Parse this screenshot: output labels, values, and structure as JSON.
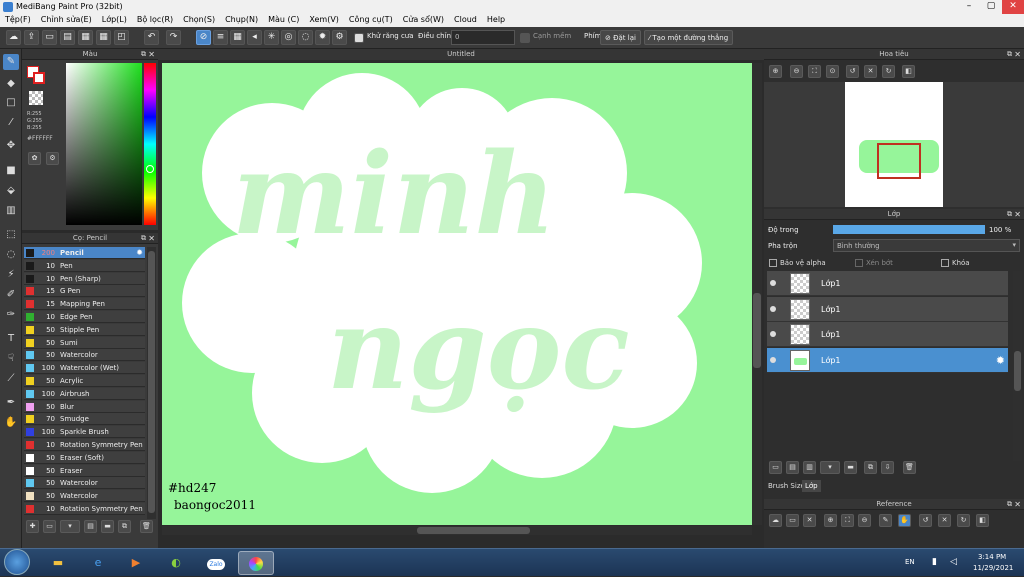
{
  "window": {
    "title": "MediBang Paint Pro (32bit)",
    "min": "–",
    "max": "▢",
    "close": "✕"
  },
  "menu": [
    "Tệp(F)",
    "Chỉnh sửa(E)",
    "Lớp(L)",
    "Bộ lọc(R)",
    "Chọn(S)",
    "Chụp(N)",
    "Màu (C)",
    "Xem(V)",
    "Công cụ(T)",
    "Cửa sổ(W)",
    "Cloud",
    "Help"
  ],
  "toolbar": {
    "antialias_label": "Khử răng cưa",
    "adjust_label": "Điều chỉnh",
    "adjust_value": "0",
    "edge_label": "Cạnh mềm",
    "key_label": "Phím",
    "reset_label": "Đặt lại",
    "straight_line_label": "Tạo một đường thẳng"
  },
  "color_panel": {
    "title": "Màu",
    "r": "R:255",
    "g": "G:255",
    "b": "B:255",
    "hex": "#FFFFFF"
  },
  "brush_panel": {
    "title": "Cọ: Pencil",
    "brushes": [
      {
        "size": "200",
        "name": "Pencil",
        "color": "#1a1a1a",
        "selected": true
      },
      {
        "size": "10",
        "name": "Pen",
        "color": "#1a1a1a"
      },
      {
        "size": "10",
        "name": "Pen (Sharp)",
        "color": "#1a1a1a"
      },
      {
        "size": "15",
        "name": "G Pen",
        "color": "#e03030"
      },
      {
        "size": "15",
        "name": "Mapping Pen",
        "color": "#e03030"
      },
      {
        "size": "10",
        "name": "Edge Pen",
        "color": "#30b030"
      },
      {
        "size": "50",
        "name": "Stipple Pen",
        "color": "#f0d020"
      },
      {
        "size": "50",
        "name": "Sumi",
        "color": "#f0d020"
      },
      {
        "size": "50",
        "name": "Watercolor",
        "color": "#60c8f0"
      },
      {
        "size": "100",
        "name": "Watercolor (Wet)",
        "color": "#60c8f0"
      },
      {
        "size": "50",
        "name": "Acrylic",
        "color": "#f0d020"
      },
      {
        "size": "100",
        "name": "Airbrush",
        "color": "#60c8f0"
      },
      {
        "size": "50",
        "name": "Blur",
        "color": "#f0a0f0"
      },
      {
        "size": "70",
        "name": "Smudge",
        "color": "#f0d020"
      },
      {
        "size": "100",
        "name": "Sparkle Brush",
        "color": "#3040e0"
      },
      {
        "size": "10",
        "name": "Rotation Symmetry Pen",
        "color": "#e03030"
      },
      {
        "size": "50",
        "name": "Eraser (Soft)",
        "color": "#ffffff"
      },
      {
        "size": "50",
        "name": "Eraser",
        "color": "#ffffff"
      },
      {
        "size": "50",
        "name": "Watercolor",
        "color": "#60c8f0"
      },
      {
        "size": "50",
        "name": "Watercolor",
        "color": "#f0e0c0"
      },
      {
        "size": "10",
        "name": "Rotation Symmetry Pen",
        "color": "#e03030"
      }
    ]
  },
  "canvas": {
    "tab_title": "Untitled",
    "word1": "minh",
    "word2": "ngọc",
    "tag1": "#hd247",
    "tag2": "baongoc2011",
    "background": "#96f59a"
  },
  "navigator": {
    "title": "Hoa tiêu"
  },
  "layer_panel": {
    "title": "Lớp",
    "opacity_label": "Độ trong",
    "opacity_value": "100 %",
    "blend_label": "Pha trộn",
    "blend_value": "Bình thường",
    "protect_alpha": "Bảo vệ alpha",
    "clipping": "Xén bớt",
    "lock": "Khóa",
    "layers": [
      {
        "name": "Lớp1",
        "selected": false
      },
      {
        "name": "Lớp1",
        "selected": false
      },
      {
        "name": "Lớp1",
        "selected": false
      },
      {
        "name": "Lớp1",
        "selected": true
      }
    ],
    "tab_brush_size": "Brush Size",
    "tab_layer": "Lớp"
  },
  "reference": {
    "title": "Reference"
  },
  "taskbar": {
    "lang": "EN",
    "time": "3:14 PM",
    "date": "11/29/2021",
    "zalo": "Zalo"
  }
}
